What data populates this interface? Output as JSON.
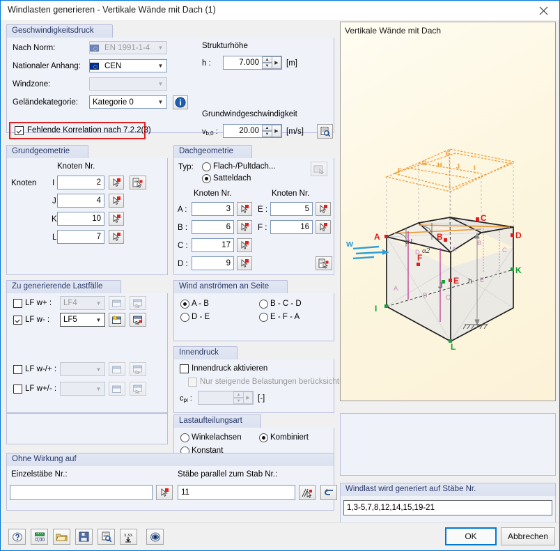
{
  "window": {
    "title": "Windlasten generieren  -  Vertikale Wände mit Dach   (1)",
    "close_icon": "close-icon"
  },
  "velocity_pressure": {
    "caption": "Geschwindigkeitsdruck",
    "standard_label": "Nach Norm:",
    "standard_value": "EN 1991-1-4",
    "annex_label": "Nationaler Anhang:",
    "annex_value": "CEN",
    "windzone_label": "Windzone:",
    "windzone_value": "",
    "terrain_label": "Geländekategorie:",
    "terrain_value": "Kategorie 0",
    "info_icon": "info-icon",
    "correlation_checkbox": "Fehlende Korrelation nach 7.2.2(3)",
    "correlation_checked": true,
    "structure_height_label": "Strukturhöhe",
    "h_label": "h :",
    "h_value": "7.000",
    "h_unit": "[m]",
    "base_velocity_label": "Grundwindgeschwindigkeit",
    "vb_label": "vb,0 :",
    "vb_value": "20.00",
    "vb_unit": "[m/s]",
    "vb_tool_icon": "table-lookup-icon"
  },
  "base_geometry": {
    "caption": "Grundgeometrie",
    "node_no_header": "Knoten Nr.",
    "nodes_label": "Knoten",
    "rows": [
      {
        "label": "I :",
        "value": "2"
      },
      {
        "label": "J :",
        "value": "4"
      },
      {
        "label": "K :",
        "value": "10"
      },
      {
        "label": "L :",
        "value": "7"
      }
    ],
    "pick_icon": "pick-node-icon",
    "pick_list_icon": "pick-node-list-icon"
  },
  "roof_geometry": {
    "caption": "Dachgeometrie",
    "type_label": "Typ:",
    "type_options": [
      {
        "label": "Flach-/Pultdach...",
        "selected": false
      },
      {
        "label": "Satteldach",
        "selected": true
      }
    ],
    "settings_icon": "roof-settings-icon",
    "node_no_header_left": "Knoten Nr.",
    "node_no_header_right": "Knoten Nr.",
    "left_rows": [
      {
        "label": "A :",
        "value": "3"
      },
      {
        "label": "B :",
        "value": "6"
      },
      {
        "label": "C :",
        "value": "17"
      },
      {
        "label": "D :",
        "value": "9"
      }
    ],
    "right_rows": [
      {
        "label": "E :",
        "value": "5"
      },
      {
        "label": "F :",
        "value": "16"
      }
    ],
    "pick_icon": "pick-node-icon",
    "pick_list_icon": "pick-node-list-icon"
  },
  "load_cases": {
    "caption": "Zu generierende Lastfälle",
    "rows": [
      {
        "label": "LF w+ :",
        "checked": false,
        "value": "LF4",
        "enabled": false
      },
      {
        "label": "LF w- :",
        "checked": true,
        "value": "LF5",
        "enabled": true
      },
      {
        "label": "LF w-/+ :",
        "checked": false,
        "value": "",
        "enabled": false
      },
      {
        "label": "LF w+/- :",
        "checked": false,
        "value": "",
        "enabled": false
      }
    ],
    "new_lc_icon": "new-load-case-icon",
    "edit_lc_icon": "edit-load-case-icon"
  },
  "wind_side": {
    "caption": "Wind anströmen an Seite",
    "options": [
      {
        "label": "A - B",
        "selected": true
      },
      {
        "label": "B - C - D",
        "selected": false
      },
      {
        "label": "D - E",
        "selected": false
      },
      {
        "label": "E - F - A",
        "selected": false
      }
    ]
  },
  "internal_pressure": {
    "caption": "Innendruck",
    "activate_label": "Innendruck aktivieren",
    "activate_checked": false,
    "rising_only_label": "Nur steigende Belastungen berücksichtigen",
    "rising_only_checked": false,
    "cpi_label": "cpi :",
    "cpi_value": "",
    "cpi_unit": "[-]"
  },
  "load_distribution": {
    "caption": "Lastaufteilungsart",
    "options": [
      {
        "label": "Winkelachsen",
        "selected": false
      },
      {
        "label": "Kombiniert",
        "selected": true
      },
      {
        "label": "Konstant",
        "selected": false
      }
    ]
  },
  "without_effect": {
    "caption": "Ohne Wirkung auf",
    "single_members_label": "Einzelstäbe Nr.:",
    "single_members_value": "",
    "parallel_members_label": "Stäbe parallel zum Stab Nr.:",
    "parallel_members_value": "11",
    "pick_icon": "pick-member-icon",
    "pick_parallel_icon": "pick-parallel-member-icon",
    "apply_icon": "apply-arrow-icon"
  },
  "preview": {
    "title": "Vertikale Wände mit Dach",
    "wind_label": "w",
    "height_label": "h",
    "alpha1": "α1",
    "alpha2": "α2",
    "roof_zone_labels": [
      "F",
      "G",
      "H",
      "I",
      "J",
      "F"
    ],
    "wall_zone_labels": [
      "A",
      "B",
      "C",
      "D",
      "E"
    ],
    "corner_labels_red": [
      "A",
      "B",
      "C",
      "D",
      "E",
      "F"
    ],
    "corner_labels_green": [
      "I",
      "J",
      "K",
      "L"
    ]
  },
  "result": {
    "caption": "Windlast wird generiert auf Stäbe Nr.",
    "value": "1,3-5,7,8,12,14,15,19-21"
  },
  "toolbar": {
    "buttons": [
      {
        "icon": "help-icon",
        "name": "help-button"
      },
      {
        "icon": "units-icon",
        "name": "units-button"
      },
      {
        "icon": "open-folder-icon",
        "name": "open-button"
      },
      {
        "icon": "save-icon",
        "name": "save-button"
      },
      {
        "icon": "preview-list-icon",
        "name": "preview-button"
      },
      {
        "icon": "decimal-places-icon",
        "name": "decimal-places-button"
      },
      {
        "icon": "visibility-icon",
        "name": "visibility-button"
      }
    ],
    "ok_label": "OK",
    "cancel_label": "Abbrechen"
  },
  "colors": {
    "accent": "#0078d7",
    "group_border": "#b9bedd",
    "group_bg": "#eff2f9",
    "caption_text": "#2a3a6b",
    "highlight_red": "#e02020",
    "preview_bg": "#fdf6e0",
    "roof_orange": "#ef9428",
    "node_red": "#e01b1b",
    "node_green": "#14a03c",
    "wind_blue": "#2f9fd8",
    "zone_pink": "#c0399a"
  }
}
